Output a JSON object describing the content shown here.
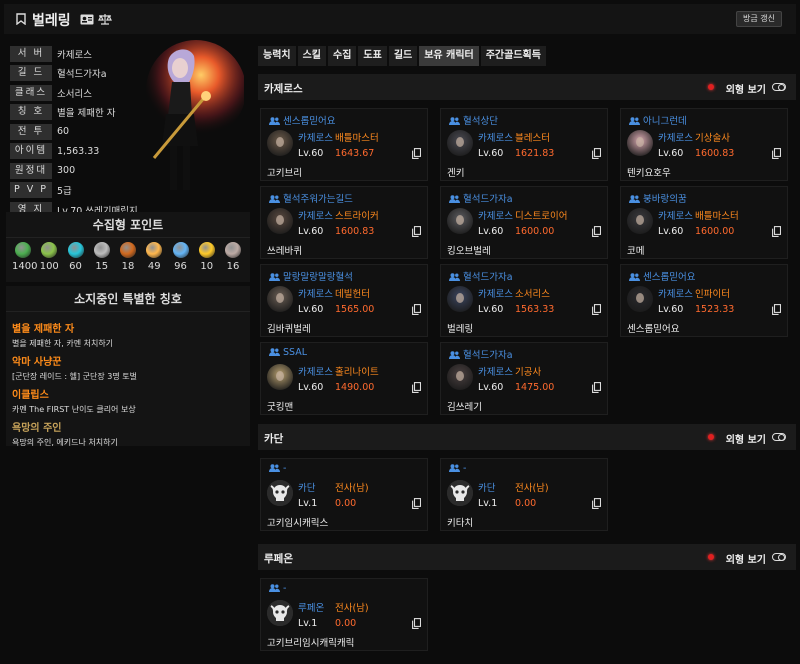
{
  "header": {
    "title": "벌레링",
    "refresh_label": "방금 갱신"
  },
  "profile": {
    "rows": [
      {
        "label": "서 버",
        "value": "카제로스"
      },
      {
        "label": "길 드",
        "value": "혈석드가자a"
      },
      {
        "label": "클래스",
        "value": "소서리스"
      },
      {
        "label": "칭 호",
        "value": "별을 제패한 자"
      },
      {
        "label": "전 투",
        "value": "60"
      },
      {
        "label": "아이템",
        "value": "1,563.33"
      },
      {
        "label": "원정대",
        "value": "300"
      },
      {
        "label": "P V P",
        "value": "5급"
      },
      {
        "label": "영 지",
        "value": "Lv.70 쓰레기매립지"
      }
    ]
  },
  "collect": {
    "heading": "수집형 포인트",
    "items": [
      {
        "icon": "island-heart-icon",
        "value": "1400",
        "color": "#4caf50"
      },
      {
        "icon": "giant-heart-icon",
        "value": "100",
        "color": "#8bc34a"
      },
      {
        "icon": "masterpiece-icon",
        "value": "60",
        "color": "#26c6da"
      },
      {
        "icon": "mokoko-seed-icon",
        "value": "15",
        "color": "#bdbdbd"
      },
      {
        "icon": "adventure-book-icon",
        "value": "18",
        "color": "#d2691e"
      },
      {
        "icon": "ignea-token-icon",
        "value": "49",
        "color": "#ffb74d"
      },
      {
        "icon": "orpheus-star-icon",
        "value": "96",
        "color": "#64b5f6"
      },
      {
        "icon": "world-tree-leaf-icon",
        "value": "10",
        "color": "#ffca28"
      },
      {
        "icon": "sea-bounty-icon",
        "value": "16",
        "color": "#bcaaa4"
      }
    ]
  },
  "titles": {
    "heading": "소지중인 특별한 칭호",
    "items": [
      {
        "name": "별을 제패한 자",
        "desc": "별을 제패한 자, 카멘 처치하기",
        "color": "#ff8c1a"
      },
      {
        "name": "악마 사냥꾼",
        "desc": "[군단장 레이드 : 헬] 군단장 3명 토벌",
        "color": "#ff8c1a"
      },
      {
        "name": "이클립스",
        "desc": "카멘 The FIRST 난이도 클리어 보상",
        "color": "#ff8c1a"
      },
      {
        "name": "욕망의 주인",
        "desc": "욕망의 주인, 에키드나 처치하기",
        "color": "#c7a35a"
      }
    ]
  },
  "tabs": [
    "능력치",
    "스킬",
    "수집",
    "도표",
    "길드",
    "보유 캐릭터",
    "주간골드획득"
  ],
  "active_tab": 5,
  "look_label": "외형 보기",
  "sections": [
    {
      "name": "카제로스",
      "cards": [
        {
          "guild": "센스롭믿어요",
          "server": "카제로스",
          "cls": "배틀마스터",
          "lv": "Lv.60",
          "item_level": "1643.67",
          "name": "고키브리",
          "tone": "#6b5a4a"
        },
        {
          "guild": "혈석상단",
          "server": "카제로스",
          "cls": "블레스터",
          "lv": "Lv.60",
          "item_level": "1621.83",
          "name": "겐키",
          "tone": "#4a4a52"
        },
        {
          "guild": "아니그런데",
          "server": "카제로스",
          "cls": "기상술사",
          "lv": "Lv.60",
          "item_level": "1600.83",
          "name": "텐키요호우",
          "tone": "#d8a8b0"
        },
        {
          "guild": "혈석주워가는길드",
          "server": "카제로스",
          "cls": "스트라이커",
          "lv": "Lv.60",
          "item_level": "1600.83",
          "name": "쓰레바퀴",
          "tone": "#5a4a40"
        },
        {
          "guild": "혈석드가자a",
          "server": "카제로스",
          "cls": "디스트로이어",
          "lv": "Lv.60",
          "item_level": "1600.00",
          "name": "킹오브벌레",
          "tone": "#5c5c60"
        },
        {
          "guild": "붕바랑의꿈",
          "server": "카제로스",
          "cls": "배틀마스터",
          "lv": "Lv.60",
          "item_level": "1600.00",
          "name": "코메",
          "tone": "#3a3a3e"
        },
        {
          "guild": "말랑말랑말랑혈석",
          "server": "카제로스",
          "cls": "데빌헌터",
          "lv": "Lv.60",
          "item_level": "1565.00",
          "name": "김바퀴벌레",
          "tone": "#6a5e54"
        },
        {
          "guild": "혈석드가자a",
          "server": "카제로스",
          "cls": "소서리스",
          "lv": "Lv.60",
          "item_level": "1563.33",
          "name": "벌레링",
          "tone": "#3c4660"
        },
        {
          "guild": "센스롭믿어요",
          "server": "카제로스",
          "cls": "인파이터",
          "lv": "Lv.60",
          "item_level": "1523.33",
          "name": "센스롭믿어요",
          "tone": "#2a2a2e"
        },
        {
          "guild": "SSAL",
          "server": "카제로스",
          "cls": "홀리나이트",
          "lv": "Lv.60",
          "item_level": "1490.00",
          "name": "굿킹맨",
          "tone": "#b8a070"
        },
        {
          "guild": "혈석드가자a",
          "server": "카제로스",
          "cls": "기공사",
          "lv": "Lv.60",
          "item_level": "1475.00",
          "name": "김쓰레기",
          "tone": "#4a4040"
        }
      ]
    },
    {
      "name": "카단",
      "cards": [
        {
          "guild": "-",
          "server": "카단",
          "cls": "전사(남)",
          "lv": "Lv.1",
          "item_level": "0.00",
          "name": "고키임시캐릭스",
          "tone": "#2b2b2b"
        },
        {
          "guild": "-",
          "server": "카단",
          "cls": "전사(남)",
          "lv": "Lv.1",
          "item_level": "0.00",
          "name": "키타치",
          "tone": "#2b2b2b"
        }
      ]
    },
    {
      "name": "루페온",
      "cards": [
        {
          "guild": "-",
          "server": "루페온",
          "cls": "전사(남)",
          "lv": "Lv.1",
          "item_level": "0.00",
          "name": "고키브리임시캐릭캐릭",
          "tone": "#2b2b2b"
        }
      ]
    }
  ]
}
